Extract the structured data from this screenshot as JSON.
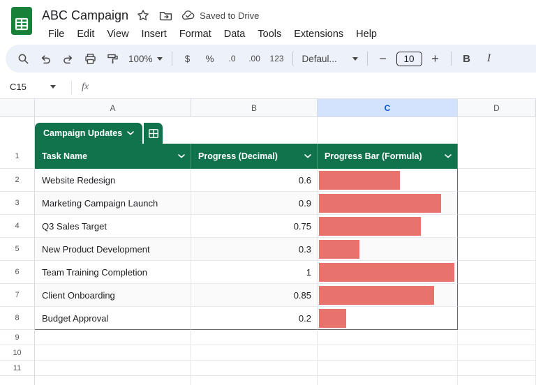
{
  "colors": {
    "table_green": "#11734b",
    "bar_red": "#e8736c",
    "selected_header_bg": "#d3e3fd",
    "selected_header_text": "#0b57d0",
    "logo_green": "#188038"
  },
  "header": {
    "title": "ABC Campaign",
    "saved_status": "Saved to Drive",
    "menus": [
      "File",
      "Edit",
      "View",
      "Insert",
      "Format",
      "Data",
      "Tools",
      "Extensions",
      "Help"
    ]
  },
  "toolbar": {
    "zoom": "100%",
    "currency": "$",
    "percent": "%",
    "decimal_decrease": ".0",
    "decimal_increase": ".00",
    "more_formats": "123",
    "font_name": "Defaul...",
    "minus": "−",
    "font_size": "10",
    "plus": "+",
    "bold": "B",
    "italic": "I"
  },
  "formula_bar": {
    "name_box": "C15",
    "fx": "fx"
  },
  "grid": {
    "columns": [
      "A",
      "B",
      "C",
      "D"
    ],
    "selected_column": "C",
    "rows": [
      "1",
      "2",
      "3",
      "4",
      "5",
      "6",
      "7",
      "8",
      "9",
      "10",
      "11"
    ]
  },
  "table": {
    "name": "Campaign Updates",
    "headers": [
      "Task Name",
      "Progress (Decimal)",
      "Progress Bar (Formula)"
    ],
    "rows": [
      {
        "task": "Website Redesign",
        "progress": "0.6",
        "value": 0.6
      },
      {
        "task": "Marketing Campaign Launch",
        "progress": "0.9",
        "value": 0.9
      },
      {
        "task": "Q3 Sales Target",
        "progress": "0.75",
        "value": 0.75
      },
      {
        "task": "New Product Development",
        "progress": "0.3",
        "value": 0.3
      },
      {
        "task": "Team Training Completion",
        "progress": "1",
        "value": 1
      },
      {
        "task": "Client Onboarding",
        "progress": "0.85",
        "value": 0.85
      },
      {
        "task": "Budget Approval",
        "progress": "0.2",
        "value": 0.2
      }
    ]
  }
}
